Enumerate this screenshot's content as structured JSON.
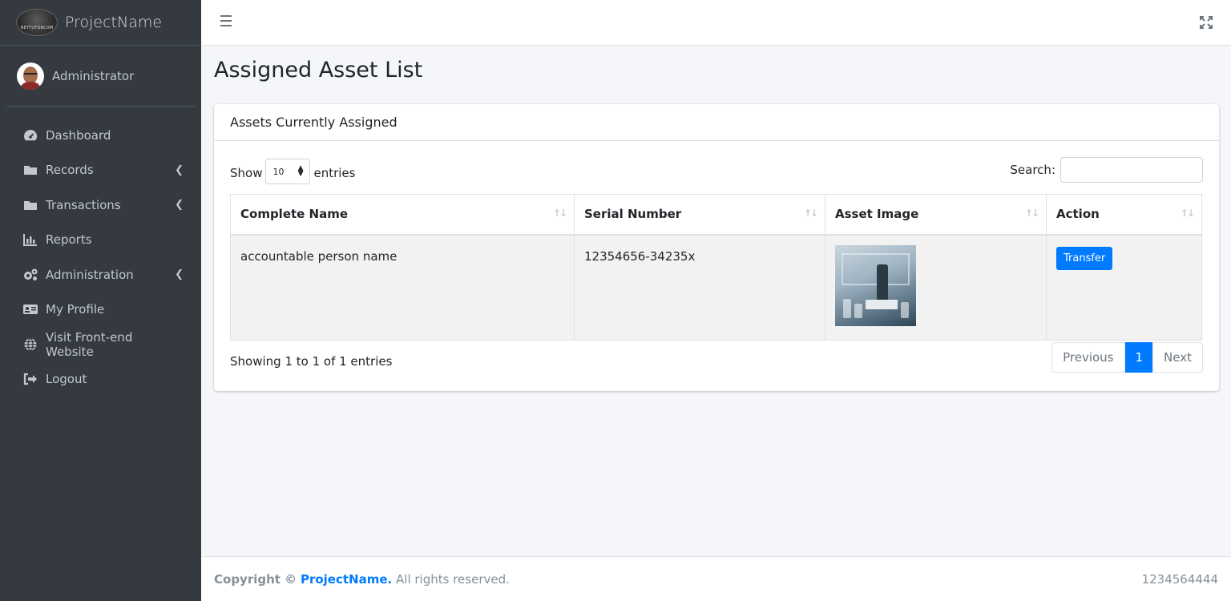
{
  "brand": {
    "name": "ProjectName",
    "logo_text": "NETTUTORCOM"
  },
  "user": {
    "name": "Administrator"
  },
  "sidebar": {
    "items": [
      {
        "label": "Dashboard",
        "icon": "tachometer-icon",
        "has_caret": false
      },
      {
        "label": "Records",
        "icon": "folder-icon",
        "has_caret": true
      },
      {
        "label": "Transactions",
        "icon": "folder-icon",
        "has_caret": true
      },
      {
        "label": "Reports",
        "icon": "bar-chart-icon",
        "has_caret": false
      },
      {
        "label": "Administration",
        "icon": "cogs-icon",
        "has_caret": true
      },
      {
        "label": "My Profile",
        "icon": "id-card-icon",
        "has_caret": false
      },
      {
        "label": "Visit Front-end Website",
        "icon": "globe-icon",
        "has_caret": false
      },
      {
        "label": "Logout",
        "icon": "sign-out-icon",
        "has_caret": false
      }
    ]
  },
  "page": {
    "title": "Assigned Asset List"
  },
  "card": {
    "title": "Assets Currently Assigned",
    "show_label": "Show",
    "entries_label": "entries",
    "entries_value": "10",
    "search_label": "Search:",
    "search_value": ""
  },
  "table": {
    "columns": [
      "Complete Name",
      "Serial Number",
      "Asset Image",
      "Action"
    ],
    "rows": [
      {
        "complete_name": "accountable person name",
        "serial_number": "12354656-34235x",
        "action_label": "Transfer"
      }
    ]
  },
  "pagination": {
    "info": "Showing 1 to 1 of 1 entries",
    "previous": "Previous",
    "current": "1",
    "next": "Next"
  },
  "footer": {
    "copyright": "Copyright ©",
    "brand": "ProjectName.",
    "rights": "All rights reserved.",
    "right_text": "1234564444"
  },
  "colors": {
    "sidebar_bg": "#343a40",
    "primary": "#007bff",
    "page_bg": "#f4f6f9"
  }
}
